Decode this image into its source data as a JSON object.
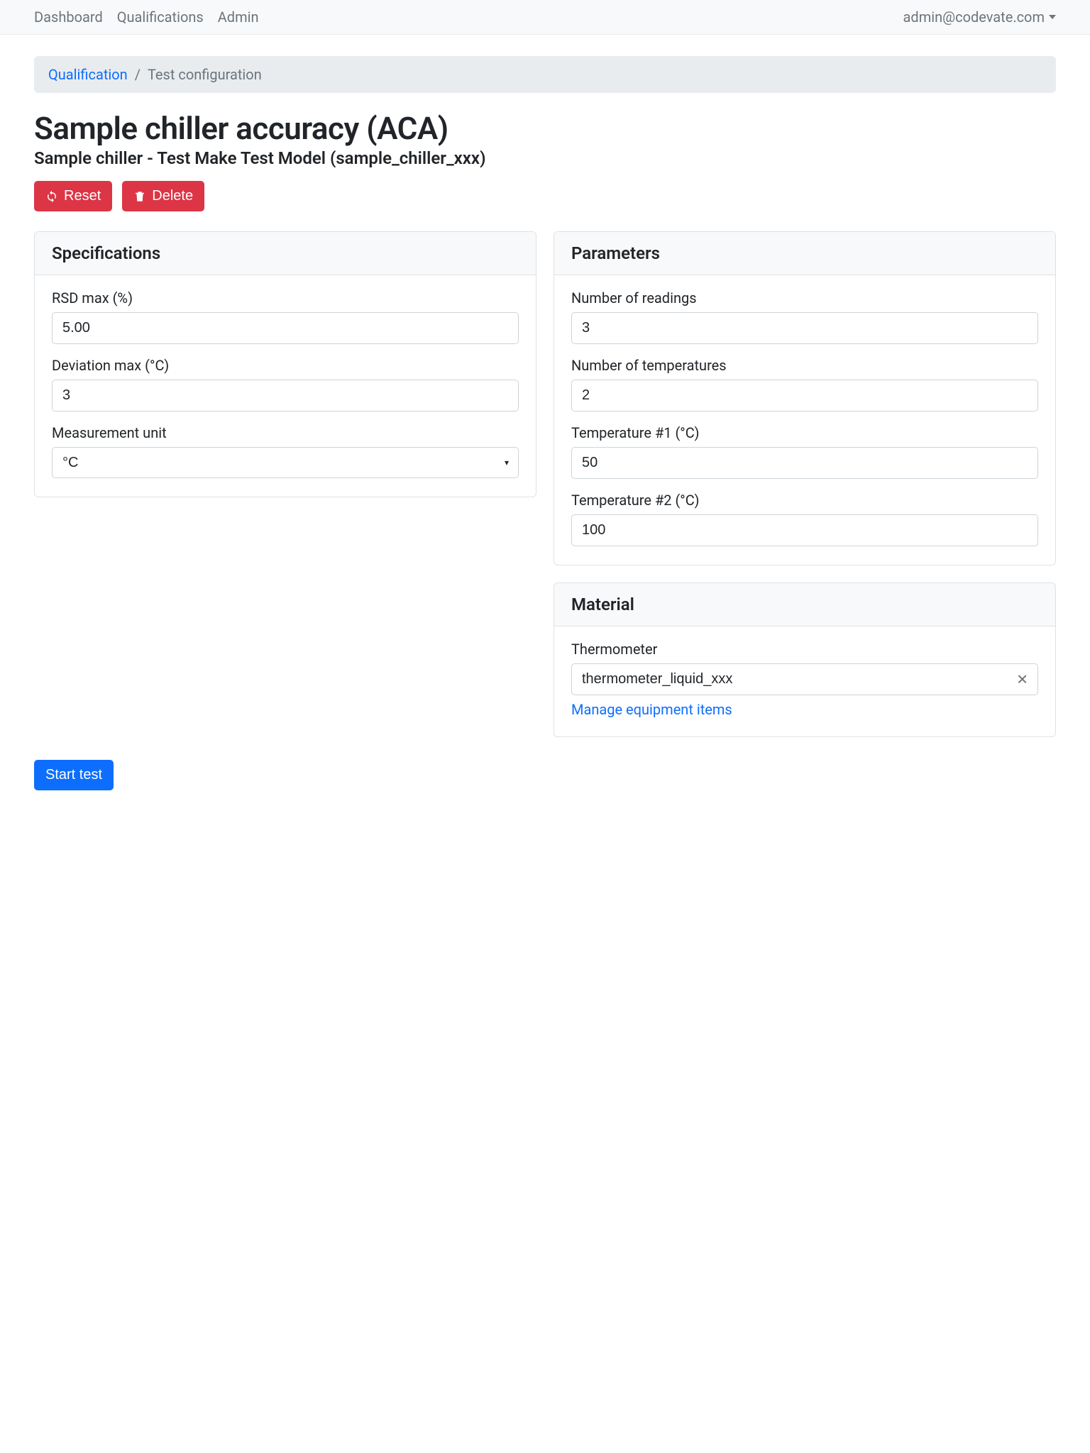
{
  "nav": {
    "items": [
      "Dashboard",
      "Qualifications",
      "Admin"
    ],
    "user": "admin@codevate.com"
  },
  "breadcrumb": {
    "link": "Qualification",
    "sep": "/",
    "current": "Test configuration"
  },
  "title": "Sample chiller accuracy (ACA)",
  "subtitle": "Sample chiller - Test Make Test Model (sample_chiller_xxx)",
  "buttons": {
    "reset": "Reset",
    "delete": "Delete",
    "start": "Start test"
  },
  "specs": {
    "header": "Specifications",
    "rsd_label": "RSD max (%)",
    "rsd_value": "5.00",
    "dev_label": "Deviation max (°C)",
    "dev_value": "3",
    "unit_label": "Measurement unit",
    "unit_value": "°C"
  },
  "params": {
    "header": "Parameters",
    "readings_label": "Number of readings",
    "readings_value": "3",
    "temps_label": "Number of temperatures",
    "temps_value": "2",
    "t1_label": "Temperature #1 (°C)",
    "t1_value": "50",
    "t2_label": "Temperature #2 (°C)",
    "t2_value": "100"
  },
  "material": {
    "header": "Material",
    "thermo_label": "Thermometer",
    "thermo_value": "thermometer_liquid_xxx",
    "manage_link": "Manage equipment items"
  }
}
